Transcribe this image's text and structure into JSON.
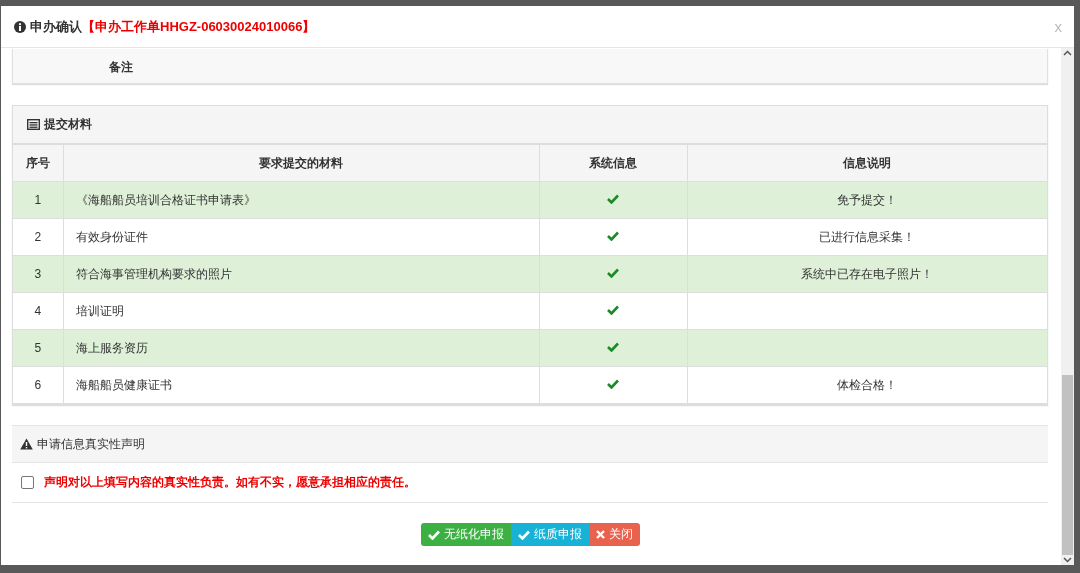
{
  "dialog": {
    "title": "申办确认",
    "work_order": "【申办工作单HHGZ-06030024010066】",
    "close": "x"
  },
  "remarks": {
    "label": "备注"
  },
  "materials": {
    "title": "提交材料",
    "columns": [
      "序号",
      "要求提交的材料",
      "系统信息",
      "信息说明"
    ],
    "rows": [
      {
        "no": "1",
        "material": "《海船船员培训合格证书申请表》",
        "system_ok": true,
        "note": "免予提交！",
        "highlighted": true
      },
      {
        "no": "2",
        "material": "有效身份证件",
        "system_ok": true,
        "note": "已进行信息采集！",
        "highlighted": false
      },
      {
        "no": "3",
        "material": "符合海事管理机构要求的照片",
        "system_ok": true,
        "note": "系统中已存在电子照片！",
        "highlighted": true
      },
      {
        "no": "4",
        "material": "培训证明",
        "system_ok": true,
        "note": "",
        "highlighted": false
      },
      {
        "no": "5",
        "material": "海上服务资历",
        "system_ok": true,
        "note": "",
        "highlighted": true
      },
      {
        "no": "6",
        "material": "海船船员健康证书",
        "system_ok": true,
        "note": "体检合格！",
        "highlighted": false
      }
    ]
  },
  "declaration": {
    "title": "申请信息真实性声明",
    "statement": "声明对以上填写内容的真实性负责。如有不实，愿意承担相应的责任。",
    "checked": false
  },
  "buttons": [
    {
      "label": "无纸化申报",
      "kind": "success"
    },
    {
      "label": "纸质申报",
      "kind": "info"
    },
    {
      "label": "关闭",
      "kind": "danger"
    }
  ]
}
